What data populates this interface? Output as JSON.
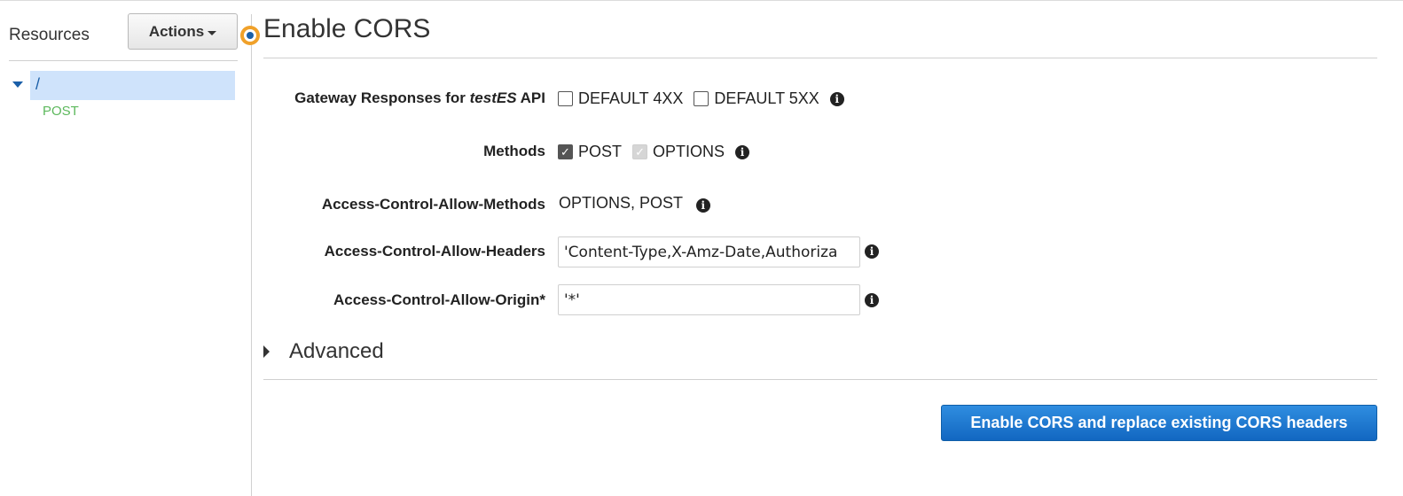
{
  "sidebar": {
    "title": "Resources",
    "actions_label": "Actions",
    "tree": {
      "root_label": "/",
      "methods": [
        "POST"
      ]
    }
  },
  "main": {
    "title": "Enable CORS",
    "gateway_responses": {
      "label_prefix": "Gateway Responses for ",
      "api_name": "testES",
      "label_suffix": " API",
      "options": [
        {
          "label": "DEFAULT 4XX",
          "checked": false
        },
        {
          "label": "DEFAULT 5XX",
          "checked": false
        }
      ]
    },
    "methods": {
      "label": "Methods",
      "options": [
        {
          "label": "POST",
          "checked": true,
          "disabled": false
        },
        {
          "label": "OPTIONS",
          "checked": true,
          "disabled": true
        }
      ]
    },
    "allow_methods": {
      "label": "Access-Control-Allow-Methods",
      "value": "OPTIONS, POST"
    },
    "allow_headers": {
      "label": "Access-Control-Allow-Headers",
      "value": "'Content-Type,X-Amz-Date,Authoriza"
    },
    "allow_origin": {
      "label": "Access-Control-Allow-Origin*",
      "value": "'*'"
    },
    "advanced_label": "Advanced",
    "submit_label": "Enable CORS and replace existing CORS headers"
  },
  "colors": {
    "accent": "#1267c1",
    "selection": "#cfe3fb",
    "method_post": "#5cb85c",
    "handle": "#f0a12a"
  },
  "icons": {
    "info": "info-icon",
    "tree_toggle": "caret-down-icon",
    "advanced_toggle": "caret-right-icon"
  }
}
